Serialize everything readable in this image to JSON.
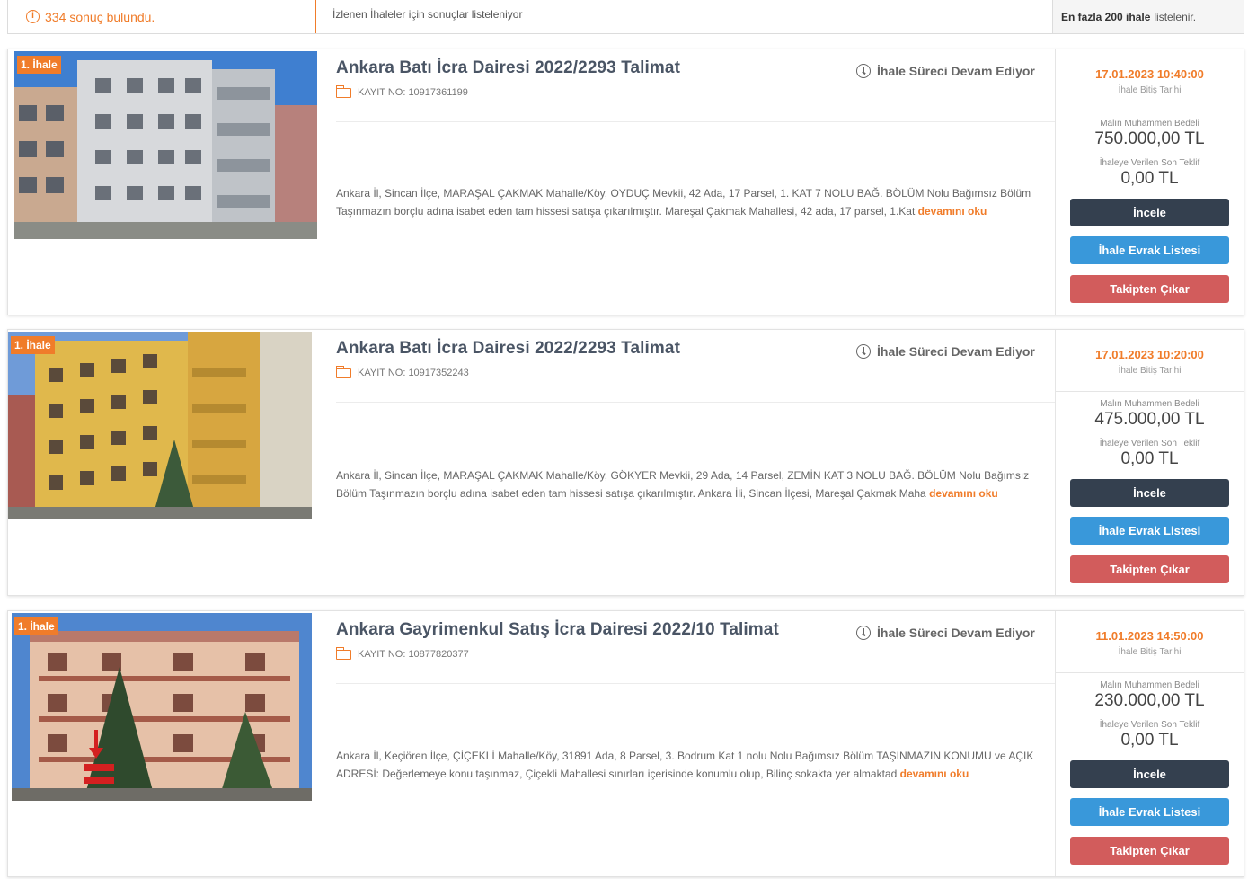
{
  "topbar": {
    "count_icon": "info-circle-icon",
    "count_number": "334",
    "count_text": "sonuç bulundu.",
    "message": "İzlenen İhaleler için sonuçlar listeleniyor",
    "limit_bold": "En fazla 200 ihale",
    "limit_text": "listelenir."
  },
  "labels": {
    "badge": "1. İhale",
    "status": "İhale Süreci Devam Ediyor",
    "date_label": "İhale Bitiş Tarihi",
    "estimated_label": "Malın Muhammen Bedeli",
    "last_bid_label": "İhaleye Verilen Son Teklif",
    "read_more": "devamını oku",
    "btn_incele": "İncele",
    "btn_evrak": "İhale Evrak Listesi",
    "btn_takip": "Takipten Çıkar"
  },
  "auctions": [
    {
      "title": "Ankara Batı İcra Dairesi 2022/2293 Talimat",
      "kayit": "KAYIT NO: 10917361199",
      "description": "Ankara İl, Sincan İlçe, MARAŞAL ÇAKMAK Mahalle/Köy, OYDUÇ Mevkii, 42 Ada, 17 Parsel, 1. KAT 7 NOLU BAĞ. BÖLÜM Nolu Bağımsız Bölüm Taşınmazın borçlu adına isabet eden tam hissesi satışa çıkarılmıştır. Mareşal Çakmak Mahallesi, 42 ada, 17 parsel, 1.Kat",
      "end_date": "17.01.2023 10:40:00",
      "estimated": "750.000,00 TL",
      "last_bid": "0,00 TL"
    },
    {
      "title": "Ankara Batı İcra Dairesi 2022/2293 Talimat",
      "kayit": "KAYIT NO: 10917352243",
      "description": "Ankara İl, Sincan İlçe, MARAŞAL ÇAKMAK Mahalle/Köy, GÖKYER Mevkii, 29 Ada, 14 Parsel, ZEMİN KAT 3 NOLU BAĞ. BÖLÜM Nolu Bağımsız Bölüm Taşınmazın borçlu adına isabet eden tam hissesi satışa çıkarılmıştır. Ankara İli, Sincan İlçesi, Mareşal Çakmak Maha",
      "end_date": "17.01.2023 10:20:00",
      "estimated": "475.000,00 TL",
      "last_bid": "0,00 TL"
    },
    {
      "title": "Ankara Gayrimenkul Satış İcra Dairesi 2022/10 Talimat",
      "kayit": "KAYIT NO: 10877820377",
      "description": "Ankara İl, Keçiören İlçe, ÇİÇEKLİ Mahalle/Köy, 31891 Ada, 8 Parsel, 3. Bodrum Kat 1 nolu Nolu Bağımsız Bölüm TAŞINMAZIN KONUMU ve AÇIK ADRESİ: Değerlemeye konu taşınmaz, Çiçekli Mahallesi sınırları içerisinde konumlu olup, Bilinç sokakta yer almaktad",
      "end_date": "11.01.2023 14:50:00",
      "estimated": "230.000,00 TL",
      "last_bid": "0,00 TL"
    }
  ]
}
